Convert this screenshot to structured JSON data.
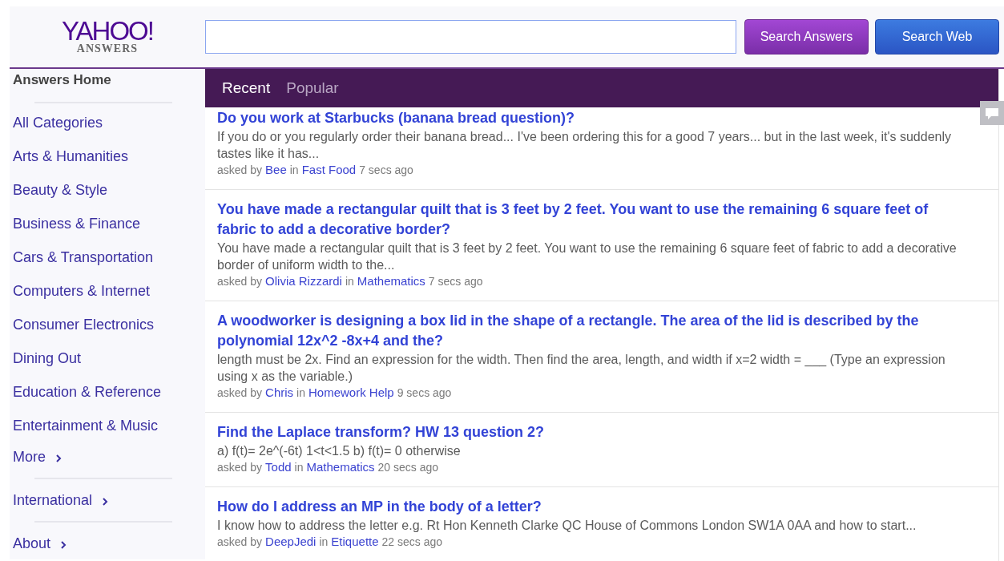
{
  "header": {
    "logo": {
      "brand": "YAHOO!",
      "sub": "ANSWERS"
    },
    "buttons": [
      {
        "label": "Search Answers",
        "kind": "answers"
      },
      {
        "label": "Search Web",
        "kind": "web"
      }
    ]
  },
  "sidebar": {
    "sections": [
      [
        {
          "label": "Answers Home",
          "kind": "home"
        }
      ],
      [
        {
          "label": "All Categories",
          "kind": "link"
        },
        {
          "label": "Arts & Humanities",
          "kind": "link"
        },
        {
          "label": "Beauty & Style",
          "kind": "link"
        },
        {
          "label": "Business & Finance",
          "kind": "link"
        },
        {
          "label": "Cars & Transportation",
          "kind": "link"
        },
        {
          "label": "Computers & Internet",
          "kind": "link"
        },
        {
          "label": "Consumer Electronics",
          "kind": "link"
        },
        {
          "label": "Dining Out",
          "kind": "link"
        },
        {
          "label": "Education & Reference",
          "kind": "link"
        },
        {
          "label": "Entertainment & Music",
          "kind": "link"
        },
        {
          "label": "More",
          "kind": "expand"
        }
      ],
      [
        {
          "label": "International",
          "kind": "expand"
        }
      ],
      [
        {
          "label": "About",
          "kind": "expand"
        }
      ]
    ]
  },
  "tabs": [
    {
      "label": "Recent",
      "selected": true
    },
    {
      "label": "Popular",
      "selected": false
    }
  ],
  "questions": [
    {
      "title": "Do you work at Starbucks (banana bread question)?",
      "excerpt": "If you do or you regularly order their banana bread... I've been ordering this for a good 7 years... but in the last week, it's suddenly tastes like it has...",
      "asked_by_label": "asked by",
      "asker": "Bee",
      "in_label": "in",
      "category": "Fast Food",
      "time": "7 secs ago"
    },
    {
      "title": "You have made a rectangular quilt that is 3 feet by 2 feet. You want to use the remaining 6 square feet of fabric to add a decorative border?",
      "excerpt": "You have made a rectangular quilt that is 3 feet by 2 feet. You want to use the remaining 6 square feet of fabric to add a decorative border of uniform width to the...",
      "asked_by_label": "asked by",
      "asker": "Olivia Rizzardi",
      "in_label": "in",
      "category": "Mathematics",
      "time": "7 secs ago"
    },
    {
      "title": "A woodworker is designing a box lid in the shape of a rectangle. The area of the lid is described by the polynomial 12x^2 -8x+4 and the?",
      "excerpt": "length must be 2x. Find an expression for the width. Then find the area, length, and width if x=2 width = ___ (Type an expression using x as the variable.)",
      "asked_by_label": "asked by",
      "asker": "Chris",
      "in_label": "in",
      "category": "Homework Help",
      "time": "9 secs ago"
    },
    {
      "title": "Find the Laplace transform? HW 13 question 2?",
      "excerpt": "a) f(t)= 2e^(-6t) 1<t<1.5 b) f(t)= 0 otherwise",
      "asked_by_label": "asked by",
      "asker": "Todd",
      "in_label": "in",
      "category": "Mathematics",
      "time": "20 secs ago"
    },
    {
      "title": "How do I address an MP in the body of a letter?",
      "excerpt": "I know how to address the letter e.g. Rt Hon Kenneth Clarke QC House of Commons London SW1A 0AA and how to start...",
      "asked_by_label": "asked by",
      "asker": "DeepJedi",
      "in_label": "in",
      "category": "Etiquette",
      "time": "22 secs ago"
    }
  ]
}
